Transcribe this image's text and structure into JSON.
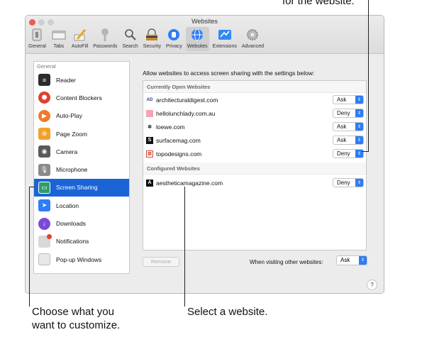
{
  "callouts": {
    "top": "for the website.",
    "left_line1": "Choose what you",
    "left_line2": "want to customize.",
    "bottom": "Select a website."
  },
  "window": {
    "title": "Websites",
    "toolbar": [
      {
        "label": "General",
        "icon": "general-icon"
      },
      {
        "label": "Tabs",
        "icon": "tabs-icon"
      },
      {
        "label": "AutoFill",
        "icon": "autofill-icon"
      },
      {
        "label": "Passwords",
        "icon": "passwords-icon"
      },
      {
        "label": "Search",
        "icon": "search-icon"
      },
      {
        "label": "Security",
        "icon": "security-icon"
      },
      {
        "label": "Privacy",
        "icon": "privacy-icon"
      },
      {
        "label": "Websites",
        "icon": "websites-icon",
        "active": true
      },
      {
        "label": "Extensions",
        "icon": "extensions-icon"
      },
      {
        "label": "Advanced",
        "icon": "advanced-icon"
      }
    ]
  },
  "sidebar": {
    "header": "General",
    "items": [
      {
        "label": "Reader",
        "icon": "reader-icon",
        "color": "#2b2b2b"
      },
      {
        "label": "Content Blockers",
        "icon": "content-blockers-icon",
        "color": "#e0402f"
      },
      {
        "label": "Auto-Play",
        "icon": "auto-play-icon",
        "color": "#f07a28"
      },
      {
        "label": "Page Zoom",
        "icon": "page-zoom-icon",
        "color": "#f2a22a"
      },
      {
        "label": "Camera",
        "icon": "camera-icon",
        "color": "#5a5a5a"
      },
      {
        "label": "Microphone",
        "icon": "microphone-icon",
        "color": "#8a8a8a"
      },
      {
        "label": "Screen Sharing",
        "icon": "screen-sharing-icon",
        "color": "#2e9d6a",
        "selected": true
      },
      {
        "label": "Location",
        "icon": "location-icon",
        "color": "#2f7cf6"
      },
      {
        "label": "Downloads",
        "icon": "downloads-icon",
        "color": "#7b49d9"
      },
      {
        "label": "Notifications",
        "icon": "notifications-icon",
        "color": "#d8d8d8"
      },
      {
        "label": "Pop-up Windows",
        "icon": "pop-up-windows-icon",
        "color": "#e8e8e8"
      }
    ]
  },
  "main": {
    "description": "Allow websites to access screen sharing with the settings below:",
    "open_header": "Currently Open Websites",
    "open_sites": [
      {
        "name": "architecturaldigest.com",
        "value": "Ask",
        "favicon": "AD"
      },
      {
        "name": "hellolunchlady.com.au",
        "value": "Deny",
        "favicon": "pink"
      },
      {
        "name": "loewe.com",
        "value": "Ask",
        "favicon": "loewe"
      },
      {
        "name": "surfacemag.com",
        "value": "Ask",
        "favicon": "S"
      },
      {
        "name": "topodesigns.com",
        "value": "Deny",
        "favicon": "topo"
      }
    ],
    "configured_header": "Configured Websites",
    "configured_sites": [
      {
        "name": "aestheticamagazine.com",
        "value": "Deny",
        "favicon": "A"
      }
    ],
    "remove_label": "Remove",
    "other_label": "When visiting other websites:",
    "other_value": "Ask",
    "help": "?"
  }
}
